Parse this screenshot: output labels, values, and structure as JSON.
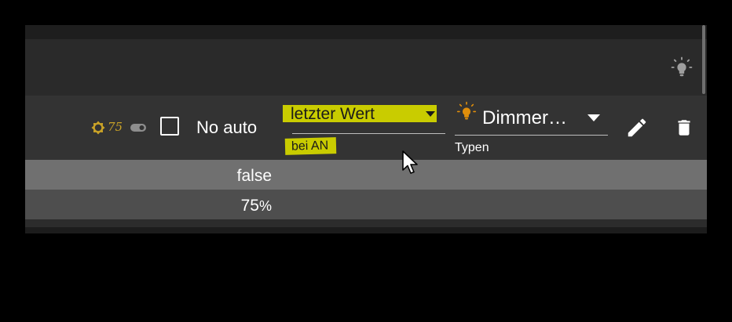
{
  "state": {
    "level_value": "75",
    "no_auto_label": "No auto",
    "no_auto_checked": false,
    "behavior_value": "letzter Wert",
    "behavior_helper": "bei AN",
    "type_value": "Dimmer…",
    "type_label": "Typen",
    "value_row": "false",
    "level_row_value": "75",
    "level_row_unit": "%"
  },
  "icons": {
    "header": "lightbulb-icon",
    "brightness": "brightness-icon",
    "toggle": "toggle-icon",
    "type": "lightbulb-icon",
    "edit": "pencil-icon",
    "delete": "trash-icon"
  },
  "colors": {
    "highlight": "#c9cc00",
    "brightness_icon": "#c9a227",
    "bulb_on": "#e08e0b",
    "bulb_off": "#9e9e9e"
  }
}
